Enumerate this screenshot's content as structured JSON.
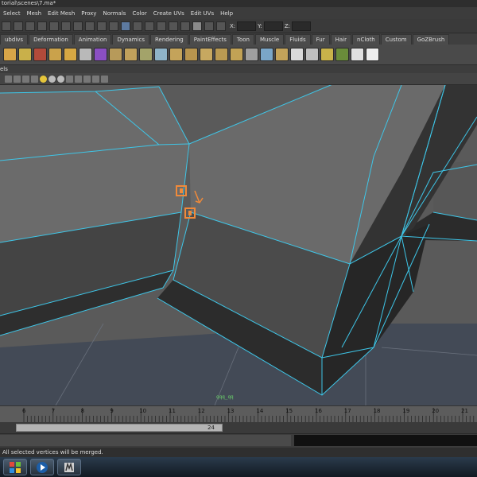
{
  "window": {
    "title": "torial\\scenes\\7.ma*"
  },
  "menu": [
    "Select",
    "Mesh",
    "Edit Mesh",
    "Proxy",
    "Normals",
    "Color",
    "Create UVs",
    "Edit UVs",
    "Help"
  ],
  "status_line": {
    "x_label": "X:",
    "y_label": "Y:",
    "z_label": "Z:"
  },
  "shelf_tabs": [
    "ubdivs",
    "Deformation",
    "Animation",
    "Dynamics",
    "Rendering",
    "PaintEffects",
    "Toon",
    "Muscle",
    "Fluids",
    "Fur",
    "Hair",
    "nCloth",
    "Custom",
    "GoZBrush"
  ],
  "panel": {
    "label": "els"
  },
  "viewport": {
    "hud_text": "qqq_qq"
  },
  "timeline": {
    "ticks": [
      "6",
      "7",
      "8",
      "9",
      "10",
      "11",
      "12",
      "13",
      "14",
      "15",
      "16",
      "17",
      "18",
      "19",
      "20",
      "21"
    ],
    "range_value": "24"
  },
  "help_line": {
    "text": "All selected vertices will be merged."
  },
  "colors": {
    "wire": "#3ec6e8",
    "selected": "#f08a3a",
    "viewport_bg": "#5a5a5a"
  },
  "icons": [
    "windows-start-icon",
    "media-player-icon",
    "maya-taskbar-icon"
  ]
}
